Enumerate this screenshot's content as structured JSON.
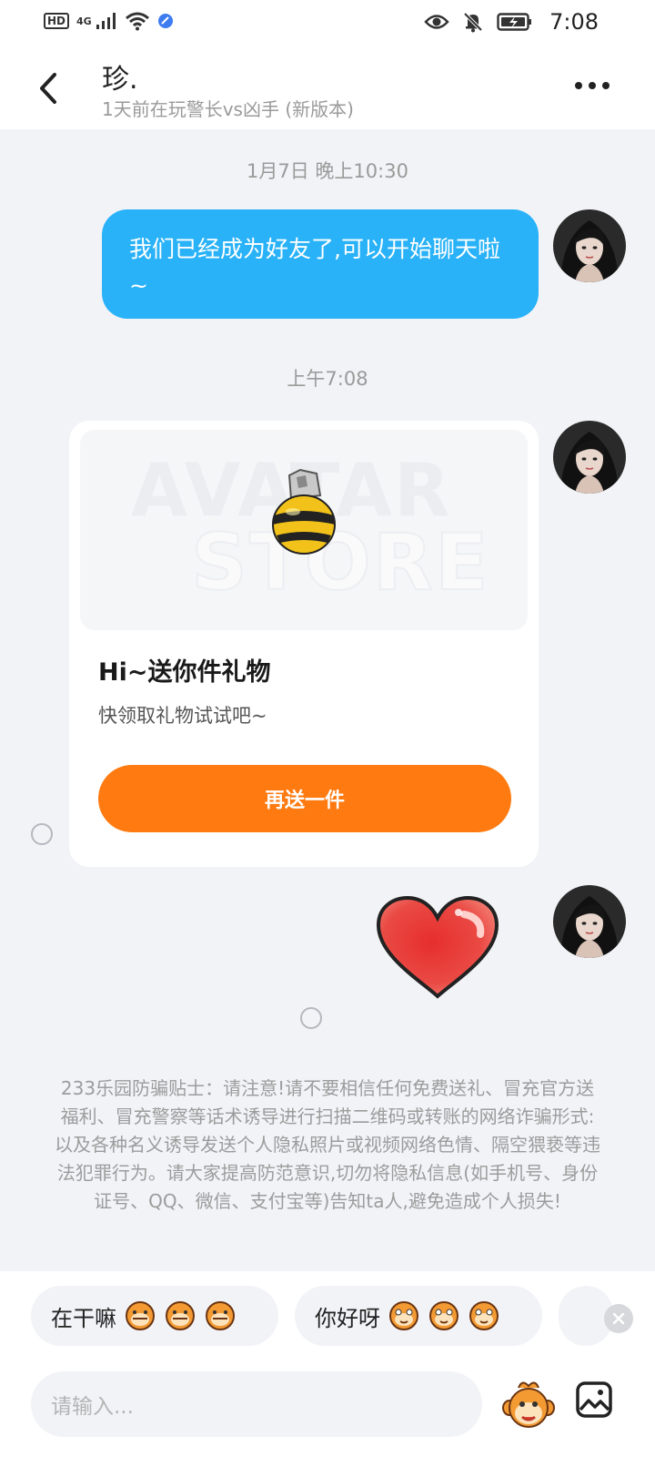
{
  "status_bar": {
    "left_icons": [
      "hd-icon",
      "signal-4g-icon",
      "wifi-icon",
      "app-notification-icon"
    ],
    "hd_label": "HD",
    "network_label": "4G",
    "right_icons": [
      "eye-comfort-icon",
      "mute-bell-icon",
      "battery-charging-icon"
    ],
    "time": "7:08"
  },
  "header": {
    "title": "珍.",
    "subtitle": "1天前在玩警长vs凶手 (新版本)"
  },
  "messages": {
    "ts1": "1月7日 晚上10:30",
    "text_bubble": "我们已经成为好友了,可以开始聊天啦~",
    "ts2": "上午7:08",
    "gift_card": {
      "watermark_line1": "AVATAR",
      "watermark_line2": "STORE",
      "title": "Hi~送你件礼物",
      "description": "快领取礼物试试吧~",
      "button_label": "再送一件"
    }
  },
  "safety_tip": "233乐园防骗贴士：请注意!请不要相信任何免费送礼、冒充官方送福利、冒充警察等话术诱导进行扫描二维码或转账的网络诈骗形式:以及各种名义诱导发送个人隐私照片或视频网络色情、隔空猥亵等违法犯罪行为。请大家提高防范意识,切勿将隐私信息(如手机号、身份证号、QQ、微信、支付宝等)告知ta人,避免造成个人损失!",
  "quick_replies": [
    {
      "label": "在干嘛"
    },
    {
      "label": "你好呀"
    }
  ],
  "input": {
    "placeholder": "请输入..."
  },
  "colors": {
    "bubble": "#29b2f8",
    "button": "#ff7a10",
    "background": "#f2f3f7"
  }
}
